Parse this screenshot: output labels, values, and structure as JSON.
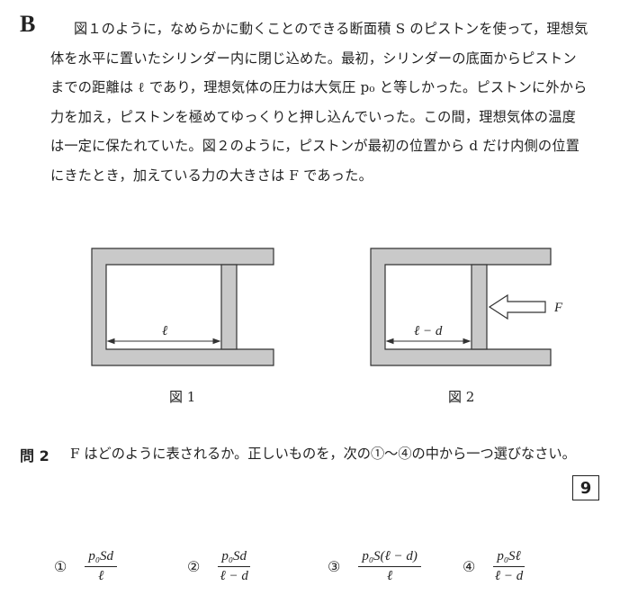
{
  "section": "B",
  "paragraph": [
    "図１のように，なめらかに動くことのできる断面積 S のピストンを使って，理想気",
    "体を水平に置いたシリンダー内に閉じ込めた。最初，シリンダーの底面からピストン",
    "までの距離は ℓ であり，理想気体の圧力は大気圧 p₀ と等しかった。ピストンに外から",
    "力を加え，ピストンを極めてゆっくりと押し込んでいった。この間，理想気体の温度",
    "は一定に保たれていた。図２のように，ピストンが最初の位置から d だけ内側の位置",
    "にきたとき，加えている力の大きさは F であった。"
  ],
  "figure1": {
    "caption": "図 1",
    "length_label": "ℓ"
  },
  "figure2": {
    "caption": "図 2",
    "length_label": "ℓ − d",
    "force_label": "F"
  },
  "question": {
    "label": "問 2",
    "text": "F はどのように表されるか。正しいものを，次の①〜④の中から一つ選びなさい。",
    "answer_box": "9"
  },
  "choices": [
    {
      "num": "①",
      "numerator": "p₀Sd",
      "denominator": "ℓ"
    },
    {
      "num": "②",
      "numerator": "p₀Sd",
      "denominator": "ℓ − d"
    },
    {
      "num": "③",
      "numerator": "p₀S(ℓ − d)",
      "denominator": "ℓ"
    },
    {
      "num": "④",
      "numerator": "p₀Sℓ",
      "denominator": "ℓ − d"
    }
  ]
}
